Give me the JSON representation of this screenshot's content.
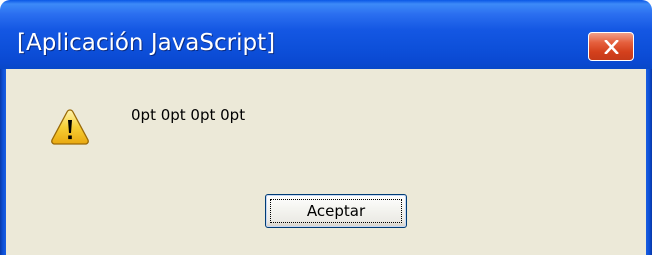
{
  "window": {
    "title": "[Aplicación JavaScript]",
    "close_icon": "close-x-icon"
  },
  "dialog": {
    "icon": "warning-icon",
    "message": "0pt 0pt 0pt 0pt",
    "ok_label": "Aceptar"
  },
  "colors": {
    "titlebar": "#0a49d2",
    "close_button": "#d4401c",
    "body": "#ece9d8",
    "warning_fill": "#f5c518"
  }
}
